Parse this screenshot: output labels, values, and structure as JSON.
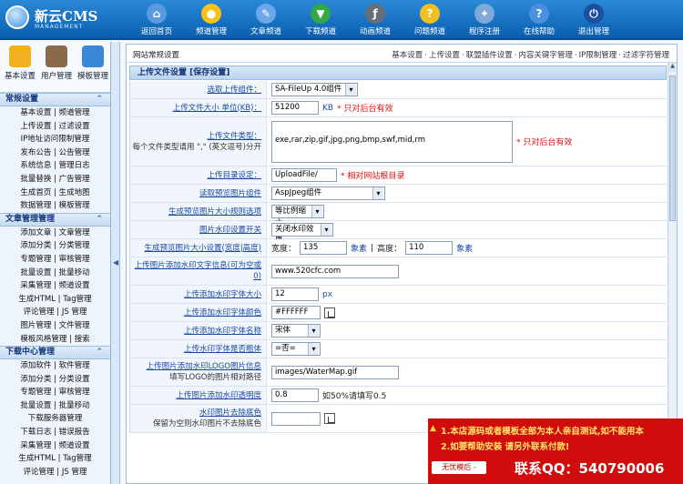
{
  "logo": {
    "name": "新云CMS",
    "sub": "MANAGEMENT"
  },
  "topnav": [
    {
      "label": "返回首页",
      "icon": "home-icon",
      "color": "#ffffff"
    },
    {
      "label": "频道管理",
      "icon": "light-bulb-icon",
      "color": "#f6c21a"
    },
    {
      "label": "文章频道",
      "icon": "pencil-icon",
      "color": "#e8f2ff"
    },
    {
      "label": "下载频道",
      "icon": "download-icon",
      "color": "#33a844"
    },
    {
      "label": "动画频道",
      "icon": "flash-icon",
      "color": "#d0d7e3"
    },
    {
      "label": "问题频道",
      "icon": "question-icon",
      "color": "#f0c020"
    },
    {
      "label": "程序注册",
      "icon": "tools-icon",
      "color": "#e8eef8"
    },
    {
      "label": "在线帮助",
      "icon": "help-icon",
      "color": "#4b8fe0"
    },
    {
      "label": "退出管理",
      "icon": "power-icon",
      "color": "#1b4fa0"
    }
  ],
  "tools": [
    {
      "label": "基本设置",
      "icon": "settings-icon"
    },
    {
      "label": "用户管理",
      "icon": "user-icon"
    },
    {
      "label": "模板管理",
      "icon": "template-icon"
    }
  ],
  "sidebar": {
    "sections": [
      {
        "title": "常规设置",
        "toggle": "⌃",
        "rows": [
          [
            "基本设置",
            "频道管理"
          ],
          [
            "上传设置",
            "过滤设置"
          ],
          [
            "IP地址访问限制管理",
            ""
          ],
          [
            "发布公告",
            "公告管理"
          ],
          [
            "系统信息",
            "管理日志"
          ],
          [
            "批量替换",
            "广告管理"
          ],
          [
            "生成首页",
            "生成地图"
          ],
          [
            "数据管理",
            "模板管理"
          ]
        ]
      },
      {
        "title": "文章管理管理",
        "toggle": "⌃",
        "rows": [
          [
            "添加文章",
            "文章管理"
          ],
          [
            "添加分类",
            "分类管理"
          ],
          [
            "专题管理",
            "审核管理"
          ],
          [
            "批量设置",
            "批量移动"
          ],
          [
            "采集管理",
            "频道设置"
          ],
          [
            "生成HTML",
            "Tag管理"
          ],
          [
            "评论管理",
            "JS 管理"
          ],
          [
            "图片管理",
            "文件管理"
          ],
          [
            "模板风格管理",
            "搜索"
          ]
        ]
      },
      {
        "title": "下载中心管理",
        "toggle": "⌃",
        "rows": [
          [
            "添加软件",
            "软件管理"
          ],
          [
            "添加分类",
            "分类设置"
          ],
          [
            "专题管理",
            "审核管理"
          ],
          [
            "批量设置",
            "批量移动"
          ],
          [
            "下载服务器管理",
            ""
          ],
          [
            "下载日志",
            "错误报告"
          ],
          [
            "采集管理",
            "频道设置"
          ],
          [
            "生成HTML",
            "Tag管理"
          ],
          [
            "评论管理",
            "JS 管理"
          ]
        ]
      }
    ]
  },
  "breadcrumb": {
    "title": "网站常规设置",
    "links": [
      "基本设置",
      "上传设置",
      "联盟插件设置",
      "内容关键字管理",
      "IP限制管理",
      "过滤字符管理"
    ]
  },
  "form": {
    "header": "上传文件设置 [保存设置]",
    "rows": [
      {
        "label": "选取上传组件：",
        "value": "SA-FileUp 4.0组件",
        "kind": "select"
      },
      {
        "label": "上传文件大小 单位(KB)：",
        "value": "51200",
        "unit": "KB",
        "note": "* 只对后台有效",
        "kind": "input"
      },
      {
        "label": "上传文件类型：",
        "sublabel": "每个文件类型请用 \",\" (英文逗号)分开",
        "value": "exe,rar,zip,gif,jpg,png,bmp,swf,mid,rm",
        "note": "* 只对后台有效",
        "kind": "textarea"
      },
      {
        "label": "上传目录设定：",
        "value": "UploadFile/",
        "note": "* 相对网站根目录",
        "kind": "input"
      },
      {
        "label": "读取预览图片组件",
        "value": "AspJpeg组件",
        "kind": "select"
      },
      {
        "label": "生成预览图片大小规则选项",
        "value": "等比例缩小",
        "kind": "select"
      },
      {
        "label": "图片水印设置开关",
        "value": "关闭水印效果",
        "kind": "select"
      },
      {
        "label": "生成预览图片大小设置(宽度|高度)",
        "width_label": "宽度：",
        "width": "135",
        "height_label": "高度：",
        "height": "110",
        "unit": "象素",
        "kind": "size"
      },
      {
        "label": "上传图片添加水印文字信息(可为空或0)",
        "value": "www.520cfc.com",
        "kind": "input"
      },
      {
        "label": "上传添加水印字体大小",
        "value": "12",
        "unit": "px",
        "kind": "input"
      },
      {
        "label": "上传添加水印字体颜色",
        "value": "#FFFFFF",
        "kind": "color"
      },
      {
        "label": "上传添加水印字体名称",
        "value": "宋体",
        "kind": "select"
      },
      {
        "label": "上传水印字体是否粗体",
        "value": "=否=",
        "kind": "select"
      },
      {
        "label": "上传图片添加水印LOGO图片信息",
        "sublabel": "填写LOGO的图片相对路径",
        "value": "images/WaterMap.gif",
        "kind": "input"
      },
      {
        "label": "上传图片添加水印透明度",
        "value": "0.8",
        "note": "如50%请填写0.5",
        "kind": "input"
      },
      {
        "label": "水印图片去除底色",
        "sublabel": "保留为空则水印图片不去除底色",
        "value": "",
        "kind": "color"
      }
    ]
  },
  "ad": {
    "line1": "1.本店源码或者模板全部为本人亲自测试,如不能用本",
    "line2": "2.如要帮助安装 请另外联系付款!",
    "button": "无忧模后 -",
    "qq": "联系QQ：540790006"
  }
}
